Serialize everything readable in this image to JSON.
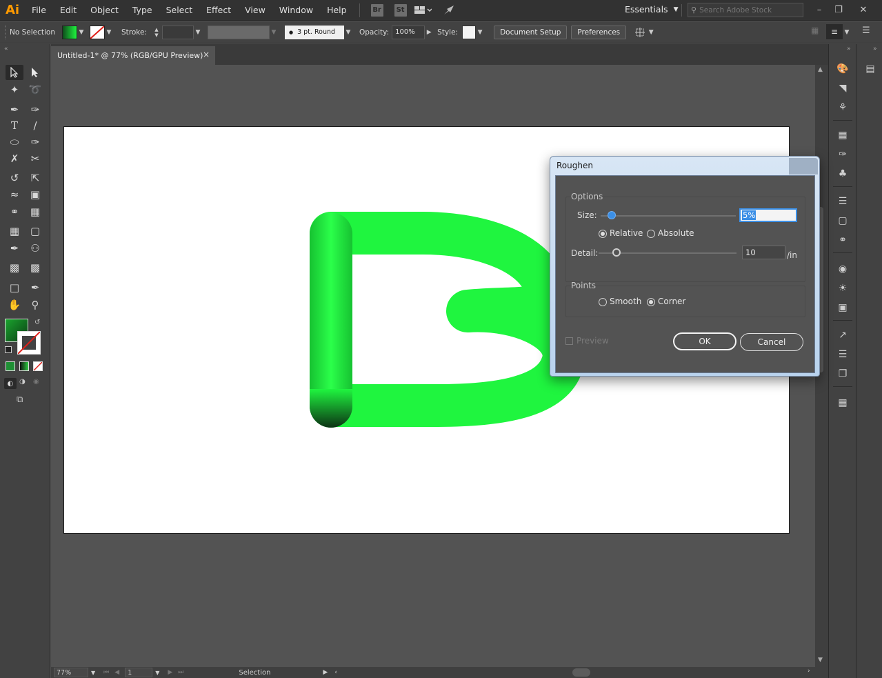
{
  "app": {
    "logo": "Ai",
    "menu": [
      "File",
      "Edit",
      "Object",
      "Type",
      "Select",
      "Effect",
      "View",
      "Window",
      "Help"
    ],
    "badges": [
      "Br",
      "St"
    ],
    "workspace": "Essentials",
    "stock_search_placeholder": "Search Adobe Stock"
  },
  "control": {
    "selection": "No Selection",
    "stroke_label": "Stroke:",
    "brush": "3 pt. Round",
    "opacity_label": "Opacity:",
    "opacity_value": "100%",
    "style_label": "Style:",
    "document_setup": "Document Setup",
    "preferences": "Preferences"
  },
  "document": {
    "tab_title": "Untitled-1* @ 77% (RGB/GPU Preview)",
    "close": "×"
  },
  "status": {
    "zoom": "77%",
    "artboard": "1",
    "tool": "Selection"
  },
  "dialog": {
    "title": "Roughen",
    "options_label": "Options",
    "size_label": "Size:",
    "size_value": "5%",
    "size_fraction": 0.05,
    "relative_label": "Relative",
    "absolute_label": "Absolute",
    "detail_label": "Detail:",
    "detail_value": "10",
    "detail_unit": "/in",
    "detail_fraction": 0.1,
    "points_label": "Points",
    "smooth_label": "Smooth",
    "corner_label": "Corner",
    "preview_label": "Preview",
    "ok": "OK",
    "cancel": "Cancel",
    "selected_mode": "Relative",
    "selected_points": "Corner"
  },
  "colors": {
    "accent_orange": "#ff9a00",
    "letter_green": "#1ff53f",
    "slider_blue": "#3b8fe6"
  }
}
